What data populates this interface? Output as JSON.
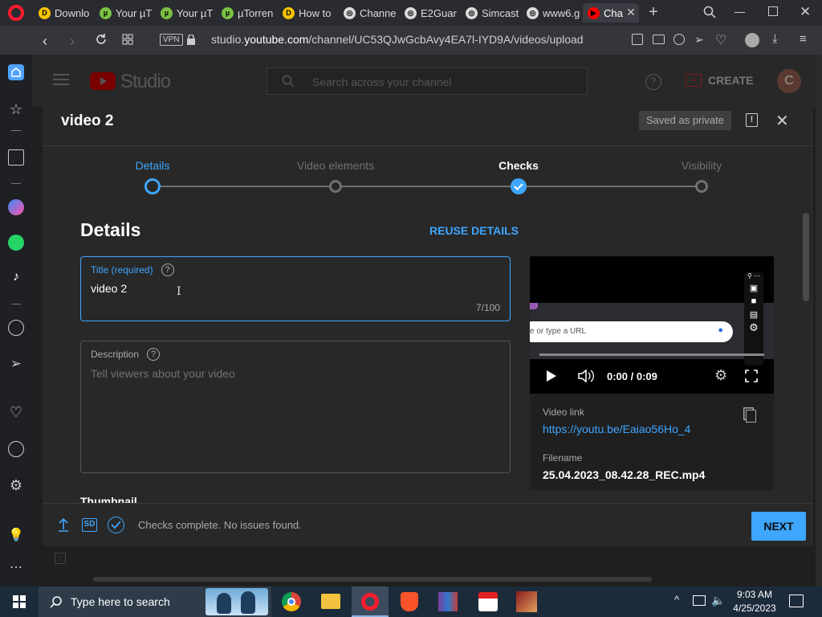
{
  "browser": {
    "tabs": [
      {
        "label": "Downlo",
        "fav_color": "#f5c400",
        "fav_text": "D"
      },
      {
        "label": "Your µT",
        "fav_color": "#7bc043",
        "fav_text": "µ"
      },
      {
        "label": "Your µT",
        "fav_color": "#7bc043",
        "fav_text": "µ"
      },
      {
        "label": "µTorren",
        "fav_color": "#7bc043",
        "fav_text": "µ"
      },
      {
        "label": "How to",
        "fav_color": "#f5c400",
        "fav_text": "D"
      },
      {
        "label": "Channe",
        "fav_color": "#dcdcdc",
        "fav_text": "◎"
      },
      {
        "label": "E2Guar",
        "fav_color": "#dcdcdc",
        "fav_text": "◎"
      },
      {
        "label": "Simcast",
        "fav_color": "#dcdcdc",
        "fav_text": "◎"
      },
      {
        "label": "www6.g",
        "fav_color": "#dcdcdc",
        "fav_text": "◎"
      },
      {
        "label": "Cha",
        "fav_color": "#ff0000",
        "fav_text": "▶"
      }
    ],
    "vpn_label": "VPN",
    "url_prefix": "studio.",
    "url_domain": "youtube.com",
    "url_path": "/channel/UC53QJwGcbAvy4EA7l-IYD9A/videos/upload"
  },
  "studio": {
    "logo_text": "Studio",
    "search_placeholder": "Search across your channel",
    "create_label": "CREATE",
    "avatar_letter": "C"
  },
  "dialog": {
    "title": "video 2",
    "saved_badge": "Saved as private",
    "steps": [
      {
        "label": "Details",
        "state": "active"
      },
      {
        "label": "Video elements",
        "state": "pending"
      },
      {
        "label": "Checks",
        "state": "done"
      },
      {
        "label": "Visibility",
        "state": "pending"
      }
    ],
    "section_title": "Details",
    "reuse_label": "REUSE DETAILS",
    "title_field": {
      "label": "Title (required)",
      "value": "video 2",
      "count": "7/100"
    },
    "description_field": {
      "label": "Description",
      "placeholder": "Tell viewers about your video"
    },
    "thumbnail_heading": "Thumbnail",
    "player": {
      "url_hint": "e or type a URL",
      "time": "0:00 / 0:09"
    },
    "video_link_label": "Video link",
    "video_link": "https://youtu.be/Eaiao56Ho_4",
    "filename_label": "Filename",
    "filename": "25.04.2023_08.42.28_REC.mp4",
    "footer": {
      "sd_badge": "SD",
      "status": "Checks complete. No issues found.",
      "next_label": "NEXT"
    }
  },
  "taskbar": {
    "search_placeholder": "Type here to search",
    "time": "9:03 AM",
    "date": "4/25/2023"
  },
  "colors": {
    "accent_blue": "#3ea6ff",
    "youtube_red": "#ff0000",
    "opera_red": "#ff1b2d"
  }
}
